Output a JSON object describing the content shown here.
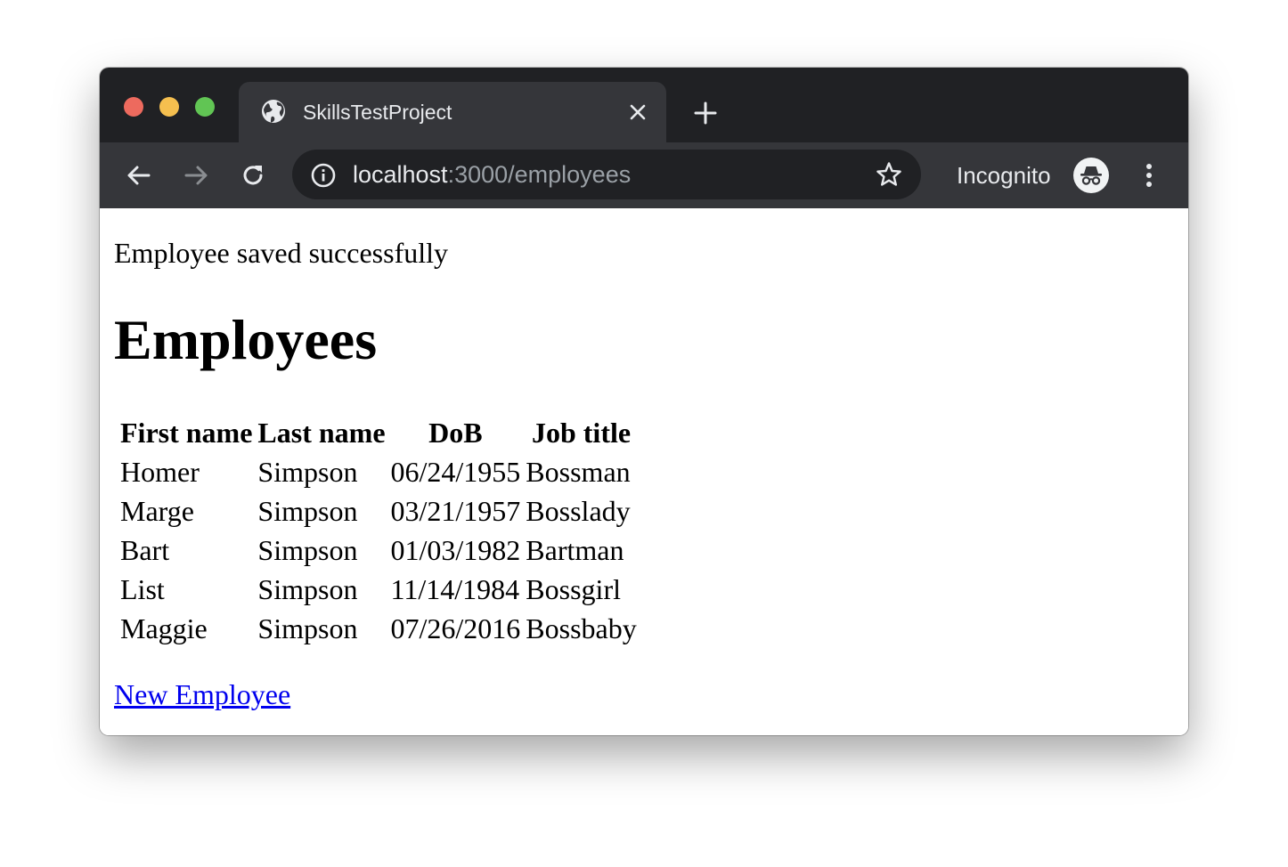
{
  "browser": {
    "tab_title": "SkillsTestProject",
    "url_host": "localhost",
    "url_path": ":3000/employees",
    "incognito_label": "Incognito"
  },
  "page": {
    "notice": "Employee saved successfully",
    "title": "Employees",
    "table": {
      "headers": [
        "First name",
        "Last name",
        "DoB",
        "Job title"
      ],
      "rows": [
        [
          "Homer",
          "Simpson",
          "06/24/1955",
          "Bossman"
        ],
        [
          "Marge",
          "Simpson",
          "03/21/1957",
          "Bosslady"
        ],
        [
          "Bart",
          "Simpson",
          "01/03/1982",
          "Bartman"
        ],
        [
          "List",
          "Simpson",
          "11/14/1984",
          "Bossgirl"
        ],
        [
          "Maggie",
          "Simpson",
          "07/26/2016",
          "Bossbaby"
        ]
      ]
    },
    "new_link": "New Employee"
  },
  "icons": {
    "tab_favicon": "globe-icon",
    "tab_close": "close-icon",
    "new_tab": "plus-icon",
    "back": "arrow-left-icon",
    "forward": "arrow-right-icon",
    "reload": "reload-icon",
    "site_info": "info-icon",
    "bookmark": "star-icon",
    "incognito": "incognito-icon",
    "menu": "kebab-menu-icon"
  },
  "colors": {
    "tabstrip": "#202124",
    "toolbar": "#35363a",
    "omnibox": "#202124",
    "link": "#0000ee",
    "close_button": "#ed6a5e",
    "minimize_button": "#f5bf4f",
    "zoom_button": "#61c554"
  }
}
